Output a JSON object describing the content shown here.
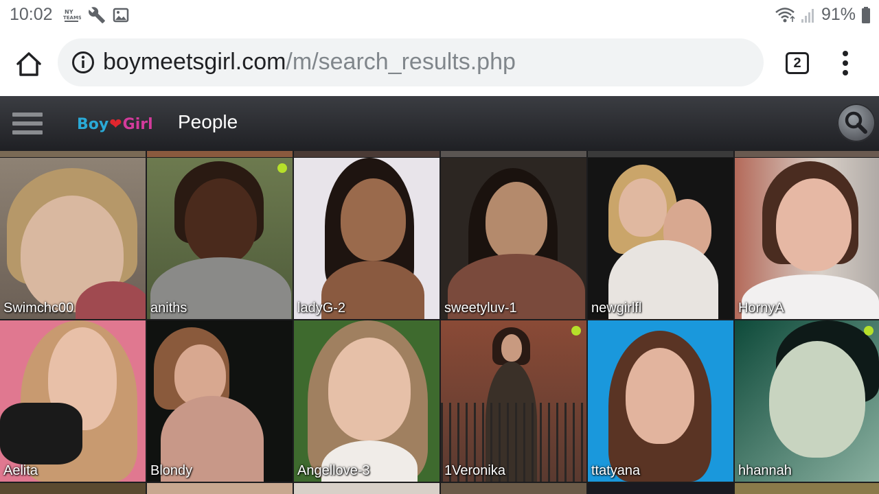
{
  "status_bar": {
    "time": "10:02",
    "battery": "91%",
    "left_icons": [
      "nyteams-icon",
      "wrench-icon",
      "image-icon"
    ],
    "right_icons": [
      "wifi-icon",
      "signal-icon",
      "battery-icon"
    ]
  },
  "browser": {
    "url_domain": "boymeetsgirl.com",
    "url_path": "/m/search_results.php",
    "tab_count": "2"
  },
  "app": {
    "logo_boy": "Boy",
    "logo_girl": "Girl",
    "title": "People"
  },
  "colors": {
    "header_dark": "#1f2024",
    "online": "#b6e02a",
    "logo_blue": "#2aa9d6",
    "logo_pink": "#d33b9b"
  },
  "profiles": [
    {
      "name": "Swimchc00",
      "online": false
    },
    {
      "name": "aniths",
      "online": true
    },
    {
      "name": "ladyG-2",
      "online": false
    },
    {
      "name": "sweetyluv-1",
      "online": false
    },
    {
      "name": "newgirlfl",
      "online": false
    },
    {
      "name": "HornyA",
      "online": false
    },
    {
      "name": "Aelita",
      "online": false
    },
    {
      "name": "Blondy",
      "online": false
    },
    {
      "name": "Angellove-3",
      "online": false
    },
    {
      "name": "1Veronika",
      "online": true
    },
    {
      "name": "ttatyana",
      "online": false
    },
    {
      "name": "hhannah",
      "online": true
    }
  ]
}
